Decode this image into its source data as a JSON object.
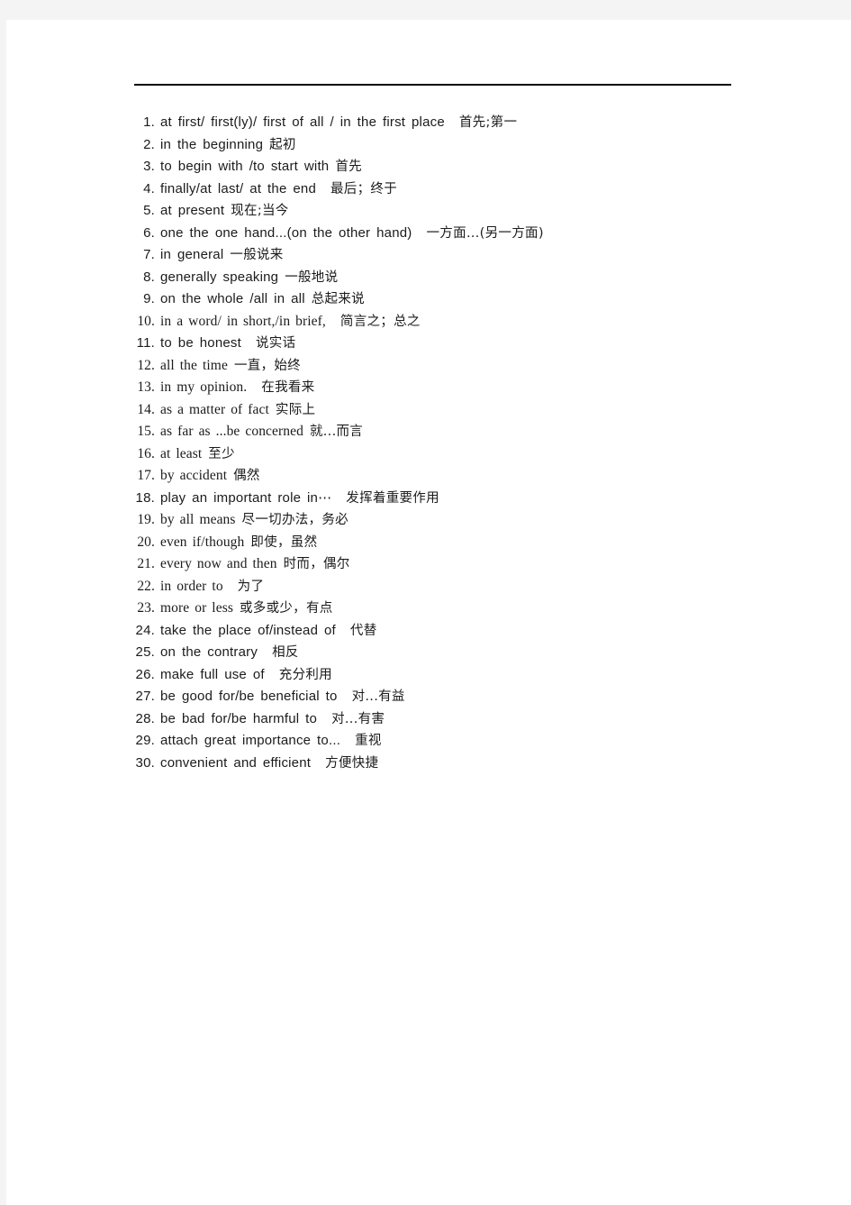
{
  "document": {
    "kind": "scanned-worksheet",
    "page_background": "#ffffff",
    "scan_margin_color": "#f4f4f5",
    "text_color": "#1b1b1b",
    "rule_color": "#000000",
    "list": [
      {
        "number": "1.",
        "english": "at first/ first(ly)/ first of all / in the first place",
        "chinese": "首先;第一",
        "font": "sans",
        "gap": "wide"
      },
      {
        "number": "2.",
        "english": "in the beginning",
        "chinese": "起初",
        "font": "sans",
        "gap": "narrow"
      },
      {
        "number": "3.",
        "english": "to begin with /to start with",
        "chinese": "首先",
        "font": "sans",
        "gap": "narrow"
      },
      {
        "number": "4.",
        "english": "finally/at last/ at the end",
        "chinese": "最后；终于",
        "font": "sans",
        "gap": "wide"
      },
      {
        "number": "5.",
        "english": "at present",
        "chinese": "现在;当今",
        "font": "sans",
        "gap": "narrow"
      },
      {
        "number": "6.",
        "english": "one the one hand...(on the other hand)",
        "chinese": "一方面…(另一方面)",
        "font": "sans",
        "gap": "wide"
      },
      {
        "number": "7.",
        "english": "in general",
        "chinese": "一般说来",
        "font": "sans",
        "gap": "narrow"
      },
      {
        "number": "8.",
        "english": "generally speaking",
        "chinese": "一般地说",
        "font": "sans",
        "gap": "narrow"
      },
      {
        "number": "9.",
        "english": "on the whole /all in all",
        "chinese": "总起来说",
        "font": "sans",
        "gap": "narrow"
      },
      {
        "number": "10.",
        "english": "in a word/ in short,/in brief,",
        "chinese": "简言之；总之",
        "font": "serif",
        "gap": "wide"
      },
      {
        "number": "11.",
        "english": "to be honest",
        "chinese": "说实话",
        "font": "sans",
        "gap": "wide"
      },
      {
        "number": "12.",
        "english": "all the time",
        "chinese": "一直，始终",
        "font": "serif",
        "gap": "narrow"
      },
      {
        "number": "13.",
        "english": "in my opinion.",
        "chinese": "在我看来",
        "font": "serif",
        "gap": "wide"
      },
      {
        "number": "14.",
        "english": "as a matter of fact",
        "chinese": "实际上",
        "font": "serif",
        "gap": "narrow"
      },
      {
        "number": "15.",
        "english": "as far as ...be concerned",
        "chinese": "就...而言",
        "font": "serif",
        "gap": "narrow"
      },
      {
        "number": "16.",
        "english": "at least",
        "chinese": "至少",
        "font": "serif",
        "gap": "narrow"
      },
      {
        "number": "17.",
        "english": "by accident",
        "chinese": "偶然",
        "font": "serif",
        "gap": "narrow"
      },
      {
        "number": "18.",
        "english": "play an important role in⋯",
        "chinese": "发挥着重要作用",
        "font": "sans",
        "gap": "wide"
      },
      {
        "number": "19.",
        "english": "by all means",
        "chinese": "尽一切办法，务必",
        "font": "serif",
        "gap": "narrow"
      },
      {
        "number": "20.",
        "english": "even if/though",
        "chinese": "即使，虽然",
        "font": "serif",
        "gap": "narrow"
      },
      {
        "number": "21.",
        "english": "every now and then",
        "chinese": "时而，偶尔",
        "font": "serif",
        "gap": "narrow"
      },
      {
        "number": "22.",
        "english": "in order to",
        "chinese": "为了",
        "font": "serif",
        "gap": "wide"
      },
      {
        "number": "23.",
        "english": "more or less",
        "chinese": "或多或少，有点",
        "font": "serif",
        "gap": "narrow"
      },
      {
        "number": "24.",
        "english": "take the place of/instead of",
        "chinese": "代替",
        "font": "sans",
        "gap": "wide"
      },
      {
        "number": "25.",
        "english": "on the contrary",
        "chinese": "相反",
        "font": "sans",
        "gap": "wide"
      },
      {
        "number": "26.",
        "english": "make full use of",
        "chinese": "充分利用",
        "font": "sans",
        "gap": "wide"
      },
      {
        "number": "27.",
        "english": "be good for/be beneficial to",
        "chinese": "对...有益",
        "font": "sans",
        "gap": "wide"
      },
      {
        "number": "28.",
        "english": "be bad for/be harmful to",
        "chinese": "对...有害",
        "font": "sans",
        "gap": "wide"
      },
      {
        "number": "29.",
        "english": "attach great importance to...",
        "chinese": "重视",
        "font": "sans",
        "gap": "wide"
      },
      {
        "number": "30.",
        "english": "convenient and efficient",
        "chinese": "方便快捷",
        "font": "sans",
        "gap": "wide"
      }
    ]
  }
}
